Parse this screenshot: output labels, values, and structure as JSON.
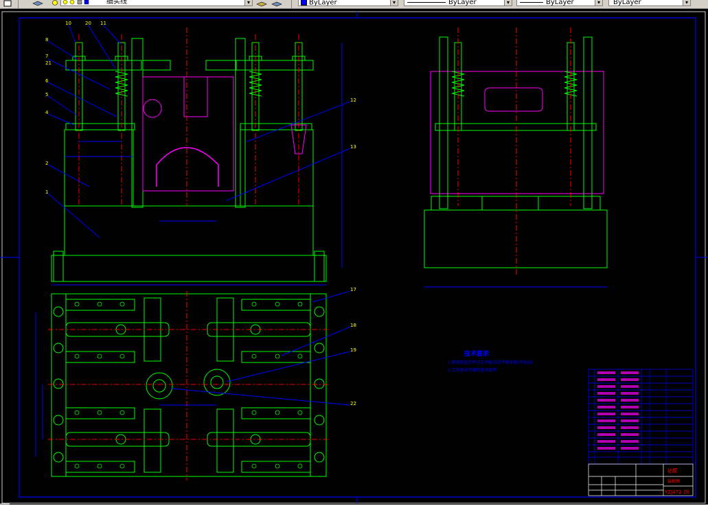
{
  "toolbar": {
    "linetype_label": "细实线",
    "color_combo": "ByLayer",
    "linetype_combo": "ByLayer",
    "lineweight_combo": "ByLayer",
    "plotstyle_combo": "ByLayer"
  },
  "drawing": {
    "tech_req_title": "技术要求",
    "tech_req_1": "1.夹具的定位件与工件配合应平稳牢固(不松动)",
    "tech_req_2": "2.工作前应仔细检查各部件",
    "part_numbers": [
      "10",
      "20",
      "11",
      "8",
      "7",
      "21",
      "6",
      "5",
      "4",
      "3",
      "2",
      "1",
      "12",
      "13",
      "17",
      "18",
      "19",
      "22"
    ],
    "drawing_number": "YZJ472-20",
    "title_left": "钻模",
    "title_right": "装配图"
  },
  "colors": {
    "outline": "#00ff00",
    "dimension": "#0000ff",
    "centerline": "#ff0000",
    "workpiece": "#ff00ff",
    "frame": "#0000ff",
    "text": "#ffff00"
  }
}
